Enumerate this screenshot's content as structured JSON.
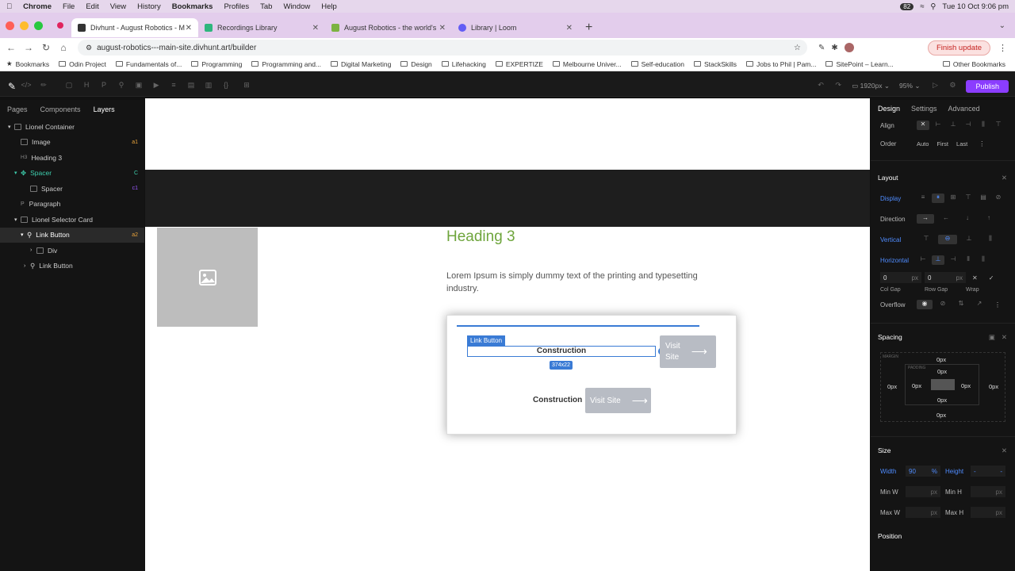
{
  "macbar": {
    "app": "Chrome",
    "menus": [
      "File",
      "Edit",
      "View",
      "History",
      "Bookmarks",
      "Profiles",
      "Tab",
      "Window",
      "Help"
    ],
    "battery": "82",
    "datetime": "Tue 10 Oct 9:06 pm"
  },
  "tabs": [
    {
      "title": "Divhunt - August Robotics - M",
      "color": "#333"
    },
    {
      "title": "Recordings Library",
      "color": "#2eb67d"
    },
    {
      "title": "August Robotics - the world's",
      "color": "#7cb342"
    },
    {
      "title": "Library | Loom",
      "color": "#625df5"
    }
  ],
  "url": "august-robotics---main-site.divhunt.art/builder",
  "finish_update": "Finish update",
  "bookmarks": [
    "Bookmarks",
    "Odin Project",
    "Fundamentals of...",
    "Programming",
    "Programming and...",
    "Digital Marketing",
    "Design",
    "Lifehacking",
    "EXPERTIZE",
    "Melbourne Univer...",
    "Self-education",
    "StackSkills",
    "Jobs to Phil | Pam...",
    "SitePoint – Learn..."
  ],
  "other_bookmarks": "Other Bookmarks",
  "builder": {
    "breakpoint": "1920px",
    "zoom": "95%",
    "publish": "Publish"
  },
  "left": {
    "tabs": [
      "Pages",
      "Components",
      "Layers"
    ],
    "layers": [
      {
        "name": "Lionel Container",
        "indent": 0,
        "badge": ""
      },
      {
        "name": "Image",
        "indent": 1,
        "badge": "a1"
      },
      {
        "name": "Heading 3",
        "indent": 1,
        "badge": ""
      },
      {
        "name": "Spacer",
        "indent": 1,
        "badge": "C"
      },
      {
        "name": "Spacer",
        "indent": 2,
        "badge": "c1"
      },
      {
        "name": "Paragraph",
        "indent": 1,
        "badge": ""
      },
      {
        "name": "Lionel Selector Card",
        "indent": 1,
        "badge": ""
      },
      {
        "name": "Link Button",
        "indent": 1,
        "badge": "a2"
      },
      {
        "name": "Div",
        "indent": 2,
        "badge": ""
      },
      {
        "name": "Link Button",
        "indent": 1,
        "badge": ""
      }
    ]
  },
  "canvas": {
    "heading": "Heading 3",
    "paragraph": "Lorem Ipsum is simply dummy text of the printing and typesetting industry.",
    "link_label": "Link Button",
    "construction": "Construction",
    "size_badge": "374x22",
    "visit": "Visit Site",
    "visit_wrapped": "Visit\nSite"
  },
  "right": {
    "tabs": [
      "Design",
      "Settings",
      "Advanced"
    ],
    "align": "Align",
    "order": "Order",
    "order_opts": [
      "Auto",
      "First",
      "Last"
    ],
    "layout": "Layout",
    "display": "Display",
    "direction": "Direction",
    "vertical": "Vertical",
    "horizontal": "Horizontal",
    "col_gap": "0",
    "row_gap": "0",
    "unit": "px",
    "col_gap_lbl": "Col Gap",
    "row_gap_lbl": "Row Gap",
    "wrap": "Wrap",
    "overflow": "Overflow",
    "spacing": "Spacing",
    "margin": "MARGIN",
    "padding": "PADDING",
    "zero": "0px",
    "size": "Size",
    "width_lbl": "Width",
    "width_val": "90",
    "width_unit": "%",
    "height_lbl": "Height",
    "height_val": "-",
    "minw": "Min W",
    "minh": "Min H",
    "maxw": "Max W",
    "maxh": "Max H",
    "position": "Position"
  }
}
